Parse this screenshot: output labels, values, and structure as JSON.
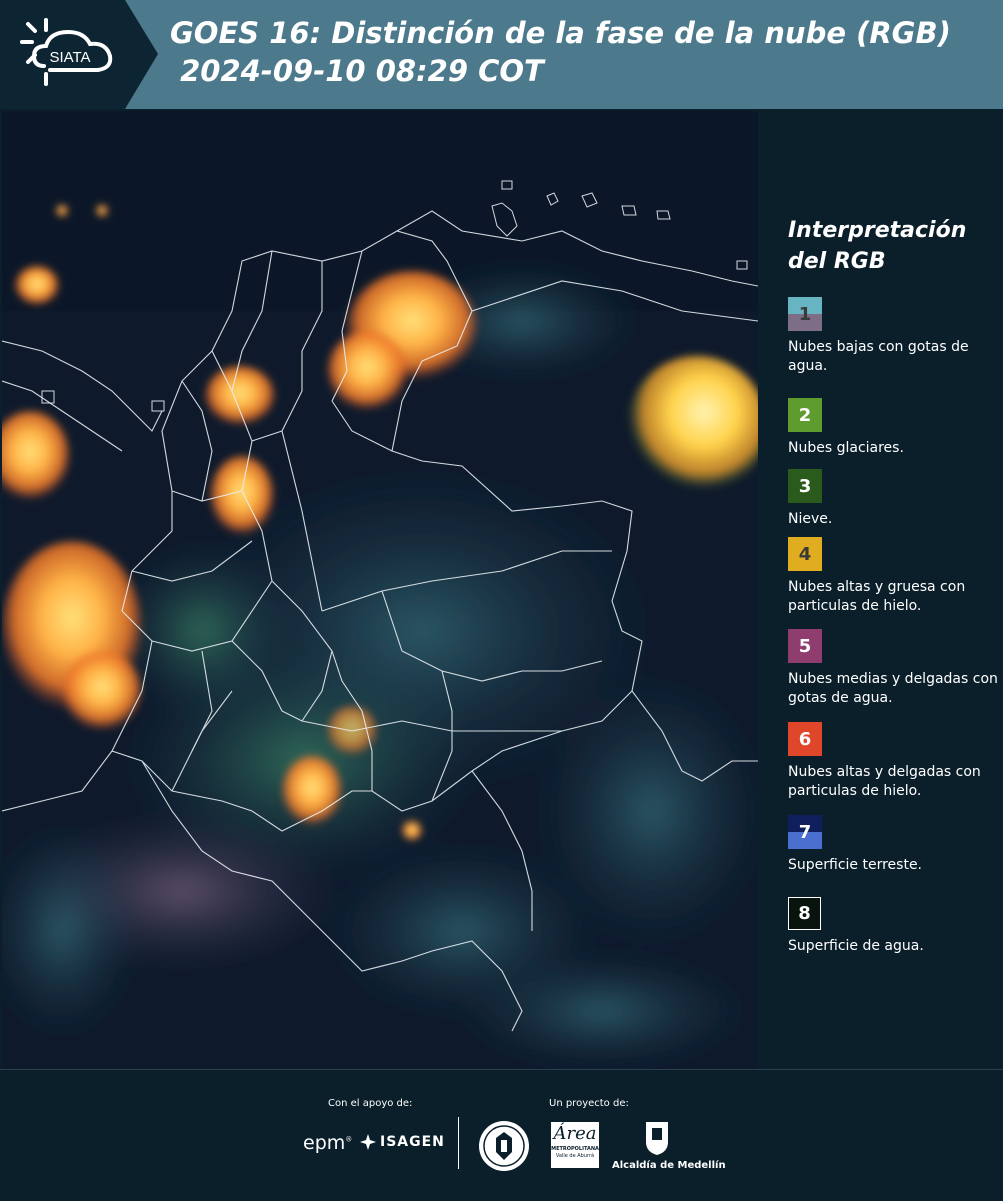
{
  "header": {
    "logo_text": "SIATA",
    "title_line1": "GOES 16: Distinción de la fase de la nube (RGB)",
    "title_line2": " 2024-09-10 08:29 COT"
  },
  "legend": {
    "title": "Interpretación del RGB",
    "items": [
      {
        "number": "1",
        "label": "Nubes bajas con gotas de agua.",
        "color_top": "#67b5c2",
        "color_bottom": "#7d6d86"
      },
      {
        "number": "2",
        "label": "Nubes glaciares.",
        "color_top": "#5f9c2f",
        "color_bottom": "#5f9c2f"
      },
      {
        "number": "3",
        "label": "Nieve.",
        "color_top": "#2a5a1c",
        "color_bottom": "#2a5a1c"
      },
      {
        "number": "4",
        "label": "Nubes altas y gruesa con particulas de hielo.",
        "color_top": "#e1ad20",
        "color_bottom": "#e1ad20"
      },
      {
        "number": "5",
        "label": "Nubes medias y delgadas con gotas de agua.",
        "color_top": "#8e3d6e",
        "color_bottom": "#8e3d6e"
      },
      {
        "number": "6",
        "label": "Nubes altas y delgadas con particulas de hielo.",
        "color_top": "#e0472a",
        "color_bottom": "#e0472a"
      },
      {
        "number": "7",
        "label": "Superficie terreste.",
        "color_top": "#0f1f5e",
        "color_bottom": "#4a6fcf"
      },
      {
        "number": "8",
        "label": "Superficie de agua.",
        "color_top": "#0a140f",
        "color_bottom": "#0a140f"
      }
    ]
  },
  "footer": {
    "support_label": "Con el apoyo de:",
    "project_label": "Un proyecto de:",
    "epm": "epm",
    "isagen": "ISAGEN",
    "area_name": "METROPOLITANA",
    "area_sub": "Valle de Aburrá",
    "alcaldia": "Alcaldía de Medellín"
  }
}
